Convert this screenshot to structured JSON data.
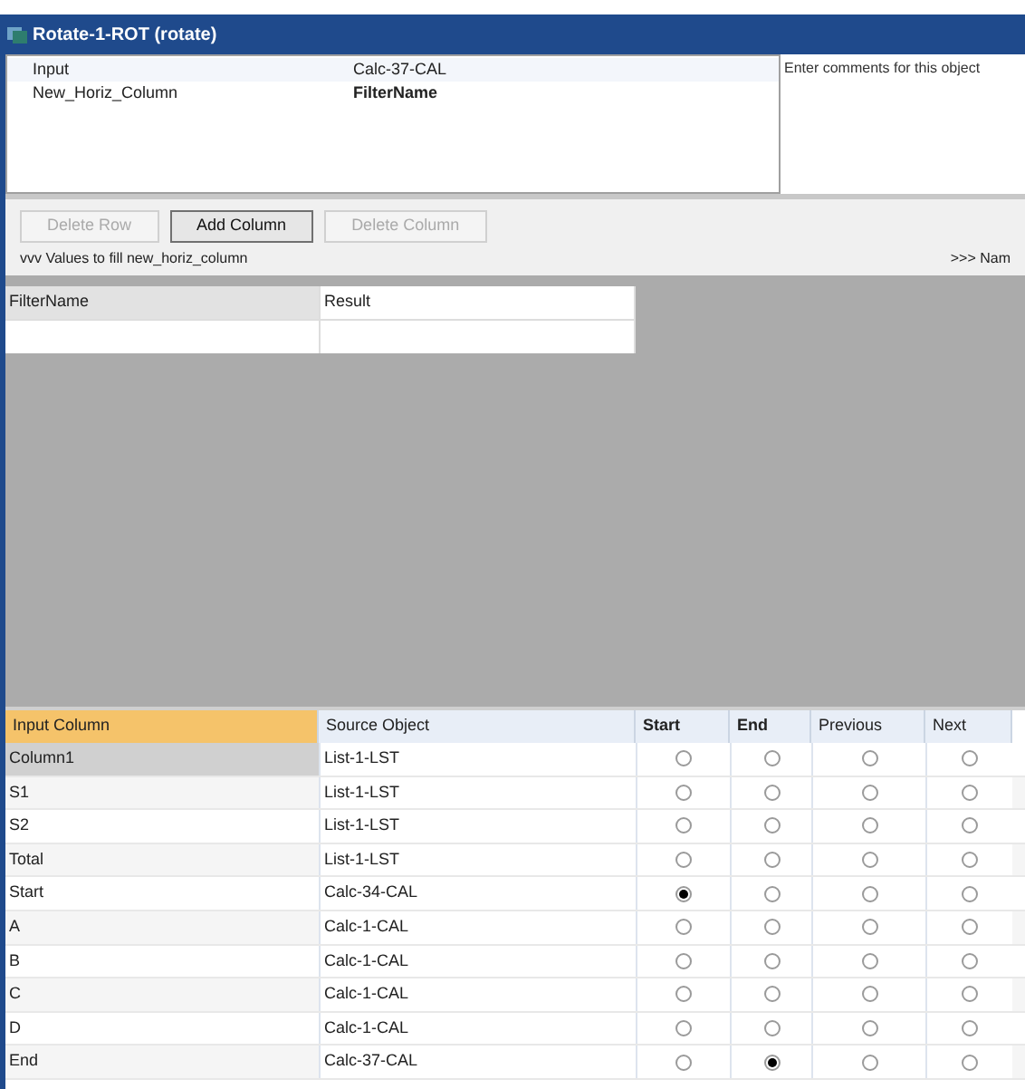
{
  "window": {
    "title": "Rotate-1-ROT (rotate)"
  },
  "properties": [
    {
      "name": "Input",
      "value": "Calc-37-CAL",
      "bold": false
    },
    {
      "name": "New_Horiz_Column",
      "value": "FilterName",
      "bold": true
    }
  ],
  "comments": {
    "placeholder": "Enter comments for this object"
  },
  "toolbar": [
    {
      "label": "Delete Row",
      "disabled": true
    },
    {
      "label": "Add Column",
      "disabled": false
    },
    {
      "label": "Delete Column",
      "disabled": true
    }
  ],
  "values_label": "vvv Values to fill new_horiz_column",
  "names_label": ">>> Nam",
  "values_grid": {
    "columns": [
      "FilterName",
      "Result"
    ]
  },
  "mapping": {
    "columns": [
      {
        "label": "Input Column",
        "selected": true,
        "bold": false
      },
      {
        "label": "Source Object",
        "selected": false,
        "bold": false
      },
      {
        "label": "Start",
        "selected": false,
        "bold": true
      },
      {
        "label": "End",
        "selected": false,
        "bold": true
      },
      {
        "label": "Previous",
        "selected": false,
        "bold": false
      },
      {
        "label": "Next",
        "selected": false,
        "bold": false
      }
    ],
    "rows": [
      {
        "input": "Column1",
        "source": "List-1-LST",
        "selected": true,
        "start": false,
        "end": false,
        "previous": false,
        "next": false
      },
      {
        "input": "S1",
        "source": "List-1-LST",
        "selected": false,
        "start": false,
        "end": false,
        "previous": false,
        "next": false
      },
      {
        "input": "S2",
        "source": "List-1-LST",
        "selected": false,
        "start": false,
        "end": false,
        "previous": false,
        "next": false
      },
      {
        "input": "Total",
        "source": "List-1-LST",
        "selected": false,
        "start": false,
        "end": false,
        "previous": false,
        "next": false
      },
      {
        "input": "Start",
        "source": "Calc-34-CAL",
        "selected": false,
        "start": true,
        "end": false,
        "previous": false,
        "next": false
      },
      {
        "input": "A",
        "source": "Calc-1-CAL",
        "selected": false,
        "start": false,
        "end": false,
        "previous": false,
        "next": false
      },
      {
        "input": "B",
        "source": "Calc-1-CAL",
        "selected": false,
        "start": false,
        "end": false,
        "previous": false,
        "next": false
      },
      {
        "input": "C",
        "source": "Calc-1-CAL",
        "selected": false,
        "start": false,
        "end": false,
        "previous": false,
        "next": false
      },
      {
        "input": "D",
        "source": "Calc-1-CAL",
        "selected": false,
        "start": false,
        "end": false,
        "previous": false,
        "next": false
      },
      {
        "input": "End",
        "source": "Calc-37-CAL",
        "selected": false,
        "start": false,
        "end": true,
        "previous": false,
        "next": false
      }
    ]
  }
}
